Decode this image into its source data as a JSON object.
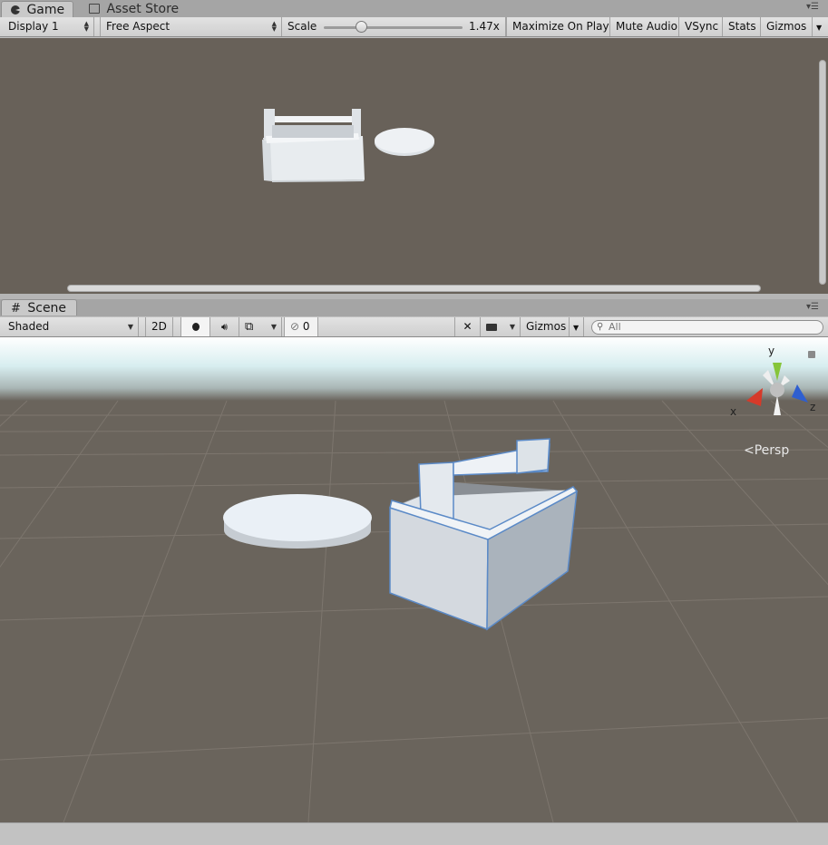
{
  "game_panel": {
    "tabs": [
      {
        "label": "Game",
        "icon": "pacman-icon",
        "active": true
      },
      {
        "label": "Asset Store",
        "icon": "lock-bag-icon",
        "active": false
      }
    ],
    "toolbar": {
      "display": "Display 1",
      "aspect": "Free Aspect",
      "scale_label": "Scale",
      "scale_value": "1.47x",
      "scale_slider_fraction": 0.25,
      "maximize_on_play": "Maximize On Play",
      "mute_audio": "Mute Audio",
      "vsync": "VSync",
      "stats": "Stats",
      "gizmos": "Gizmos"
    }
  },
  "scene_panel": {
    "tab": {
      "label": "Scene",
      "icon": "grid-hash-icon"
    },
    "toolbar": {
      "shading_mode": "Shaded",
      "mode_2d": "2D",
      "hidden_count": "0",
      "gizmos": "Gizmos",
      "search_placeholder": "All"
    },
    "orientation_gizmo": {
      "y_label": "y",
      "x_label": "x",
      "z_label": "z",
      "projection": "Persp"
    }
  },
  "colors": {
    "editor_bg": "#c2c2c2",
    "viewport_bg": "#686159",
    "object_white": "#e6eaee",
    "axis_x": "#d63a2a",
    "axis_y": "#86c53a",
    "axis_z": "#2f5fd0",
    "selection_outline": "#5b8ac7"
  }
}
